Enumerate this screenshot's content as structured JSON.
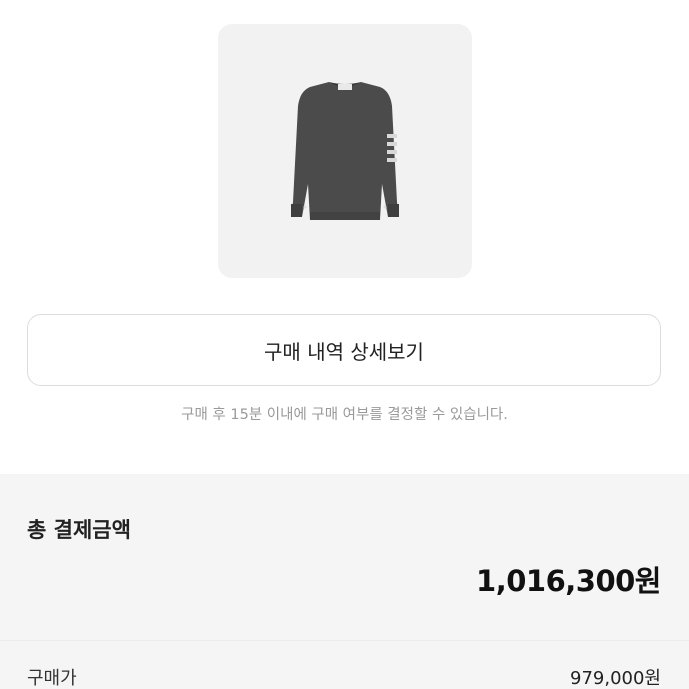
{
  "product": {
    "image_alt": "grey sweater",
    "background": "#f2f2f2",
    "sweater_color": "#4a4a4a"
  },
  "detail_button": {
    "label": "구매 내역 상세보기"
  },
  "notice": {
    "text": "구매 후 15분 이내에 구매 여부를 결정할 수 있습니다."
  },
  "payment": {
    "total_label": "총 결제금액",
    "total_value": "1,016,300원",
    "rows": [
      {
        "label": "구매가",
        "value": "979,000원"
      }
    ]
  }
}
